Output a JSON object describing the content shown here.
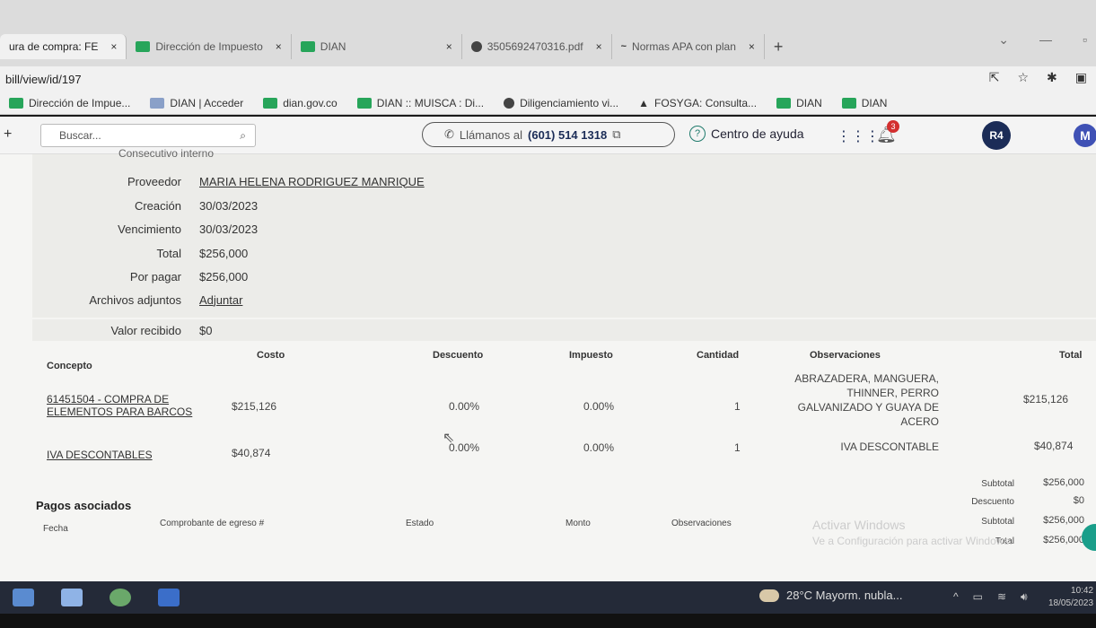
{
  "browser": {
    "tabs": [
      {
        "label": "ura de compra: FE",
        "close": "×",
        "active": true
      },
      {
        "label": "Dirección de Impuesto",
        "close": "×"
      },
      {
        "label": "DIAN",
        "close": "×"
      },
      {
        "label": "3505692470316.pdf",
        "close": "×"
      },
      {
        "label": "Normas APA con plan",
        "close": "×"
      }
    ],
    "new_tab": "+",
    "url": "bill/view/id/197",
    "bookmarks": [
      "Dirección de Impue...",
      "DIAN | Acceder",
      "dian.gov.co",
      "DIAN :: MUISCA : Di...",
      "Diligenciamiento vi...",
      "FOSYGA: Consulta...",
      "DIAN",
      "DIAN"
    ]
  },
  "header": {
    "search_placeholder": "Buscar...",
    "call_prefix": "Llámanos al",
    "call_number": "(601) 514 1318",
    "help_label": "Centro de ayuda",
    "notifications_count": "3",
    "logo_text": "R4",
    "avatar_initial": "M"
  },
  "details": {
    "cut_label": "Consecutivo interno",
    "rows": [
      {
        "label": "Proveedor",
        "value": "MARIA HELENA RODRIGUEZ MANRIQUE"
      },
      {
        "label": "Creación",
        "value": "30/03/2023"
      },
      {
        "label": "Vencimiento",
        "value": "30/03/2023"
      },
      {
        "label": "Total",
        "value": "$256,000"
      },
      {
        "label": "Por pagar",
        "value": "$256,000"
      },
      {
        "label": "Archivos adjuntos",
        "value": "Adjuntar"
      }
    ],
    "received_label": "Valor recibido",
    "received_value": "$0"
  },
  "items_table": {
    "headers": [
      "Concepto",
      "Costo",
      "Descuento",
      "Impuesto",
      "Cantidad",
      "Observaciones",
      "Total"
    ],
    "rows": [
      {
        "concepto_line1": "61451504 - COMPRA DE",
        "concepto_line2": "ELEMENTOS PARA BARCOS",
        "costo": "$215,126",
        "descuento": "0.00%",
        "impuesto": "0.00%",
        "cantidad": "1",
        "obs_lines": [
          "ABRAZADERA, MANGUERA,",
          "THINNER, PERRO",
          "GALVANIZADO Y GUAYA DE",
          "ACERO"
        ],
        "total": "$215,126"
      },
      {
        "concepto_line1": "IVA DESCONTABLES",
        "costo": "$40,874",
        "descuento": "0.00%",
        "impuesto": "0.00%",
        "cantidad": "1",
        "obs_lines": [
          "IVA DESCONTABLE"
        ],
        "total": "$40,874"
      }
    ]
  },
  "totals": [
    {
      "label": "Subtotal",
      "value": "$256,000"
    },
    {
      "label": "Descuento",
      "value": "$0"
    },
    {
      "label": "Subtotal",
      "value": "$256,000"
    },
    {
      "label": "Total",
      "value": "$256,000"
    }
  ],
  "payments": {
    "title": "Pagos asociados",
    "headers": [
      "Fecha",
      "Comprobante de egreso #",
      "Estado",
      "Monto",
      "Observaciones"
    ]
  },
  "watermark": {
    "line1": "Activar Windows",
    "line2": "Ve a Configuración para activar Windows."
  },
  "taskbar": {
    "weather": "28°C  Mayorm. nubla...",
    "time": "10:42",
    "date": "18/05/2023"
  }
}
